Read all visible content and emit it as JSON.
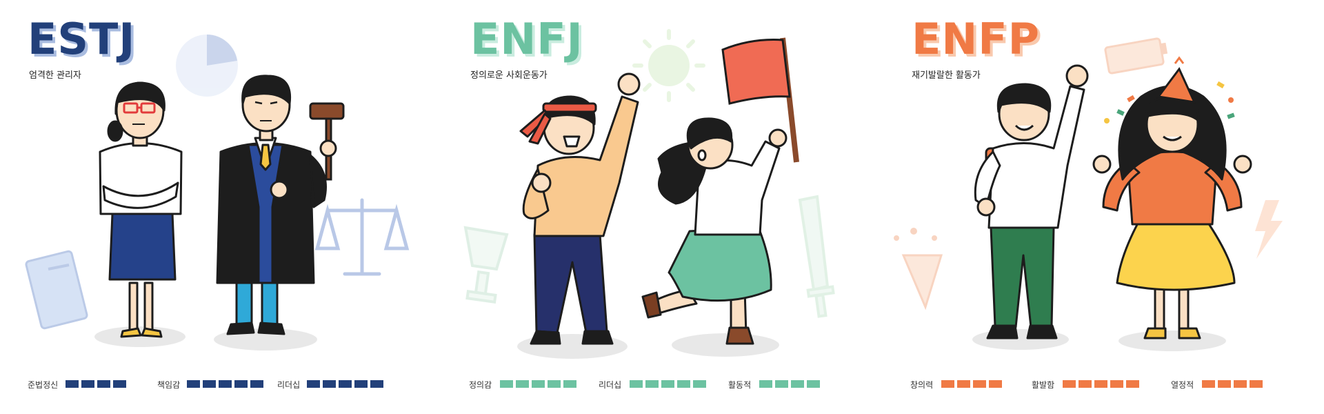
{
  "cards": [
    {
      "type": "ESTJ",
      "subtitle": "엄격한 관리자",
      "accent": "#22407a",
      "title_shadow": "#a9bce0",
      "traits": [
        {
          "label": "준법정신",
          "level": 4,
          "max": 4
        },
        {
          "label": "책임감",
          "level": 5,
          "max": 5
        },
        {
          "label": "리더십",
          "level": 5,
          "max": 5
        }
      ],
      "icons": [
        "pie-chart-icon",
        "scales-of-justice-icon",
        "law-book-icon",
        "gavel-icon"
      ],
      "figures": [
        "office-worker-woman",
        "judge-man"
      ]
    },
    {
      "type": "ENFJ",
      "subtitle": "정의로운 사회운동가",
      "accent": "#6cc2a1",
      "title_shadow": "#c9ecdf",
      "traits": [
        {
          "label": "정의감",
          "level": 5,
          "max": 5
        },
        {
          "label": "리더십",
          "level": 5,
          "max": 5
        },
        {
          "label": "활동적",
          "level": 4,
          "max": 4
        }
      ],
      "icons": [
        "sun-icon",
        "trophy-icon",
        "sword-icon",
        "red-flag-icon"
      ],
      "figures": [
        "protester-man",
        "flag-bearer-woman"
      ]
    },
    {
      "type": "ENFP",
      "subtitle": "재기발랄한 활동가",
      "accent": "#f07a45",
      "title_shadow": "#f9c9ad",
      "traits": [
        {
          "label": "창의력",
          "level": 4,
          "max": 4
        },
        {
          "label": "활발함",
          "level": 5,
          "max": 5
        },
        {
          "label": "열정적",
          "level": 4,
          "max": 4
        }
      ],
      "icons": [
        "battery-icon",
        "lightning-icon",
        "party-popper-icon",
        "party-hat-icon"
      ],
      "figures": [
        "backpack-boy",
        "party-girl"
      ]
    }
  ]
}
